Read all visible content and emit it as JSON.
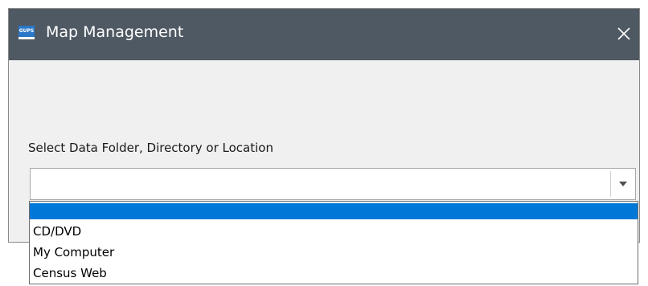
{
  "window": {
    "app_icon_text": "GUPS",
    "title": "Map Management",
    "close_glyph": "✕"
  },
  "form": {
    "location_label": "Select Data Folder, Directory or Location",
    "location_value": ""
  },
  "dropdown": {
    "options": [
      {
        "label": "",
        "selected": true
      },
      {
        "label": "CD/DVD",
        "selected": false
      },
      {
        "label": "My Computer",
        "selected": false
      },
      {
        "label": "Census Web",
        "selected": false
      }
    ]
  },
  "colors": {
    "titlebar": "#4f5963",
    "selection": "#0078d7",
    "dialog_bg": "#f0f0f0"
  }
}
